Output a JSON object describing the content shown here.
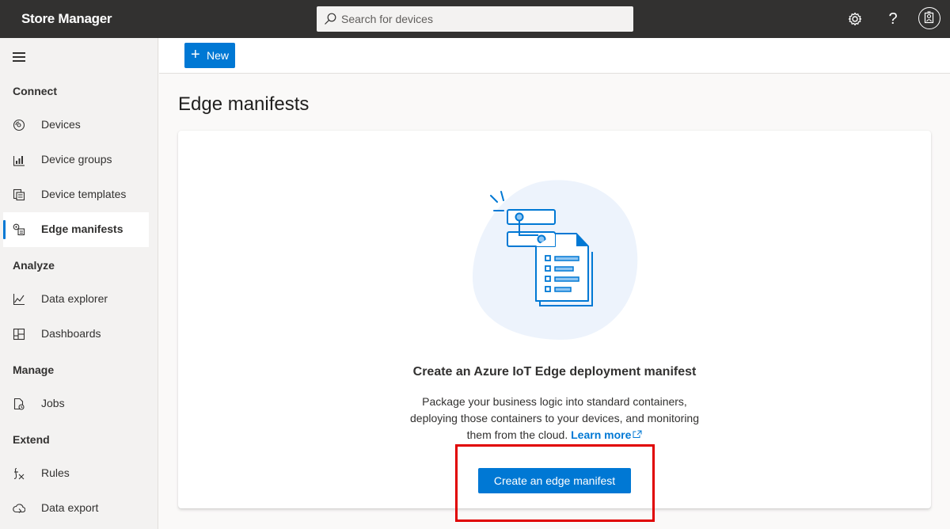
{
  "header": {
    "app_title": "Store Manager",
    "search_placeholder": "Search for devices",
    "icons": [
      "search-icon",
      "settings-icon",
      "help-icon",
      "avatar-icon"
    ],
    "help_glyph": "?"
  },
  "sidebar": {
    "sections": {
      "connect": "Connect",
      "analyze": "Analyze",
      "manage": "Manage",
      "extend": "Extend"
    },
    "items": [
      {
        "label": "Devices",
        "icon": "devices-icon"
      },
      {
        "label": "Device groups",
        "icon": "device-groups-icon"
      },
      {
        "label": "Device templates",
        "icon": "device-templates-icon"
      },
      {
        "label": "Edge manifests",
        "icon": "edge-manifests-icon",
        "active": true
      },
      {
        "label": "Data explorer",
        "icon": "data-explorer-icon"
      },
      {
        "label": "Dashboards",
        "icon": "dashboards-icon"
      },
      {
        "label": "Jobs",
        "icon": "jobs-icon"
      },
      {
        "label": "Rules",
        "icon": "rules-icon"
      },
      {
        "label": "Data export",
        "icon": "data-export-icon"
      }
    ]
  },
  "toolbar": {
    "new_label": "New",
    "new_glyph": "+"
  },
  "main": {
    "page_title": "Edge manifests",
    "empty_state": {
      "title": "Create an Azure IoT Edge deployment manifest",
      "description": "Package your business logic into standard containers, deploying those containers to your devices, and monitoring them from the cloud.",
      "learn_more": "Learn more",
      "button_label": "Create an edge manifest"
    }
  },
  "colors": {
    "accent": "#0078d4",
    "topbar": "#323130",
    "highlight": "#e00000"
  }
}
